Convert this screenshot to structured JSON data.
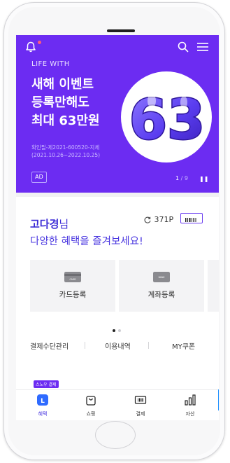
{
  "banner": {
    "tagline": "LIFE WITH",
    "headline_lines": [
      "새해 이벤트",
      "등록만해도",
      "최대 63만원"
    ],
    "promo_number": "63",
    "fine_print": [
      "확인필-제2021-600520-지체",
      "(2021.10.26~2022.10.25)"
    ],
    "ad_label": "AD",
    "page_current": "1",
    "page_separator": "/",
    "page_total": "9",
    "pause_symbol": "❚❚"
  },
  "user": {
    "name": "고다경",
    "honorific": "님",
    "greeting": "다양한 혜택을 즐겨보세요!",
    "points": "371P"
  },
  "tiles": [
    {
      "label": "카드등록",
      "badge": "CARD"
    },
    {
      "label": "계좌등록",
      "badge": "BANK"
    }
  ],
  "quick_links": [
    "결제수단관리",
    "이용내역",
    "MY쿠폰"
  ],
  "next_section_tag": "스노우 결제",
  "tabbar": [
    {
      "label": "혜택",
      "active": true
    },
    {
      "label": "쇼핑",
      "active": false
    },
    {
      "label": "결제",
      "active": false
    },
    {
      "label": "자산",
      "active": false
    }
  ],
  "colors": {
    "brand_purple": "#6c2cf2",
    "accent_text": "#4b38e0",
    "bell_dot": "#ff5b7a"
  }
}
